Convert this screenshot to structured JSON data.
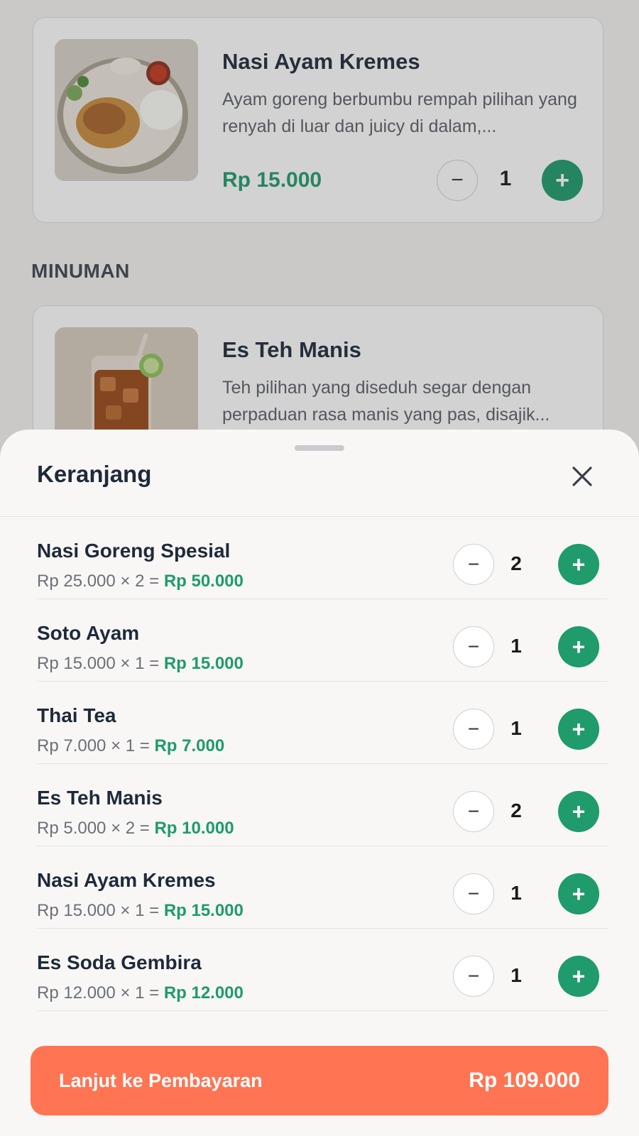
{
  "menu": {
    "cards": [
      {
        "title": "Nasi Ayam Kremes",
        "description": "Ayam goreng berbumbu rempah pilihan yang renyah di luar dan juicy di dalam,...",
        "price": "Rp 15.000",
        "quantity": "1"
      },
      {
        "title": "Es Teh Manis",
        "description": "Teh pilihan yang diseduh segar dengan perpaduan rasa manis yang pas, disajik..."
      }
    ],
    "section_heading": "MINUMAN"
  },
  "cart": {
    "title": "Keranjang",
    "items": [
      {
        "name": "Nasi Goreng Spesial",
        "unit": "Rp 25.000 × 2 = ",
        "total": "Rp 50.000",
        "quantity": "2"
      },
      {
        "name": "Soto Ayam",
        "unit": "Rp 15.000 × 1 = ",
        "total": "Rp 15.000",
        "quantity": "1"
      },
      {
        "name": "Thai Tea",
        "unit": "Rp 7.000 × 1 = ",
        "total": "Rp 7.000",
        "quantity": "1"
      },
      {
        "name": "Es Teh Manis",
        "unit": "Rp 5.000 × 2 = ",
        "total": "Rp 10.000",
        "quantity": "2"
      },
      {
        "name": "Nasi Ayam Kremes",
        "unit": "Rp 15.000 × 1 = ",
        "total": "Rp 15.000",
        "quantity": "1"
      },
      {
        "name": "Es Soda Gembira",
        "unit": "Rp 12.000 × 1 = ",
        "total": "Rp 12.000",
        "quantity": "1"
      }
    ],
    "minus_symbol": "−",
    "plus_symbol": "+",
    "checkout_label": "Lanjut ke Pembayaran",
    "checkout_total": "Rp 109.000"
  },
  "colors": {
    "accent_green": "#1f9b6c",
    "checkout_orange": "#ff7452",
    "text_dark": "#1e2a3b"
  },
  "icons": {
    "close": "close-icon",
    "minus": "minus-icon",
    "plus": "plus-icon"
  }
}
